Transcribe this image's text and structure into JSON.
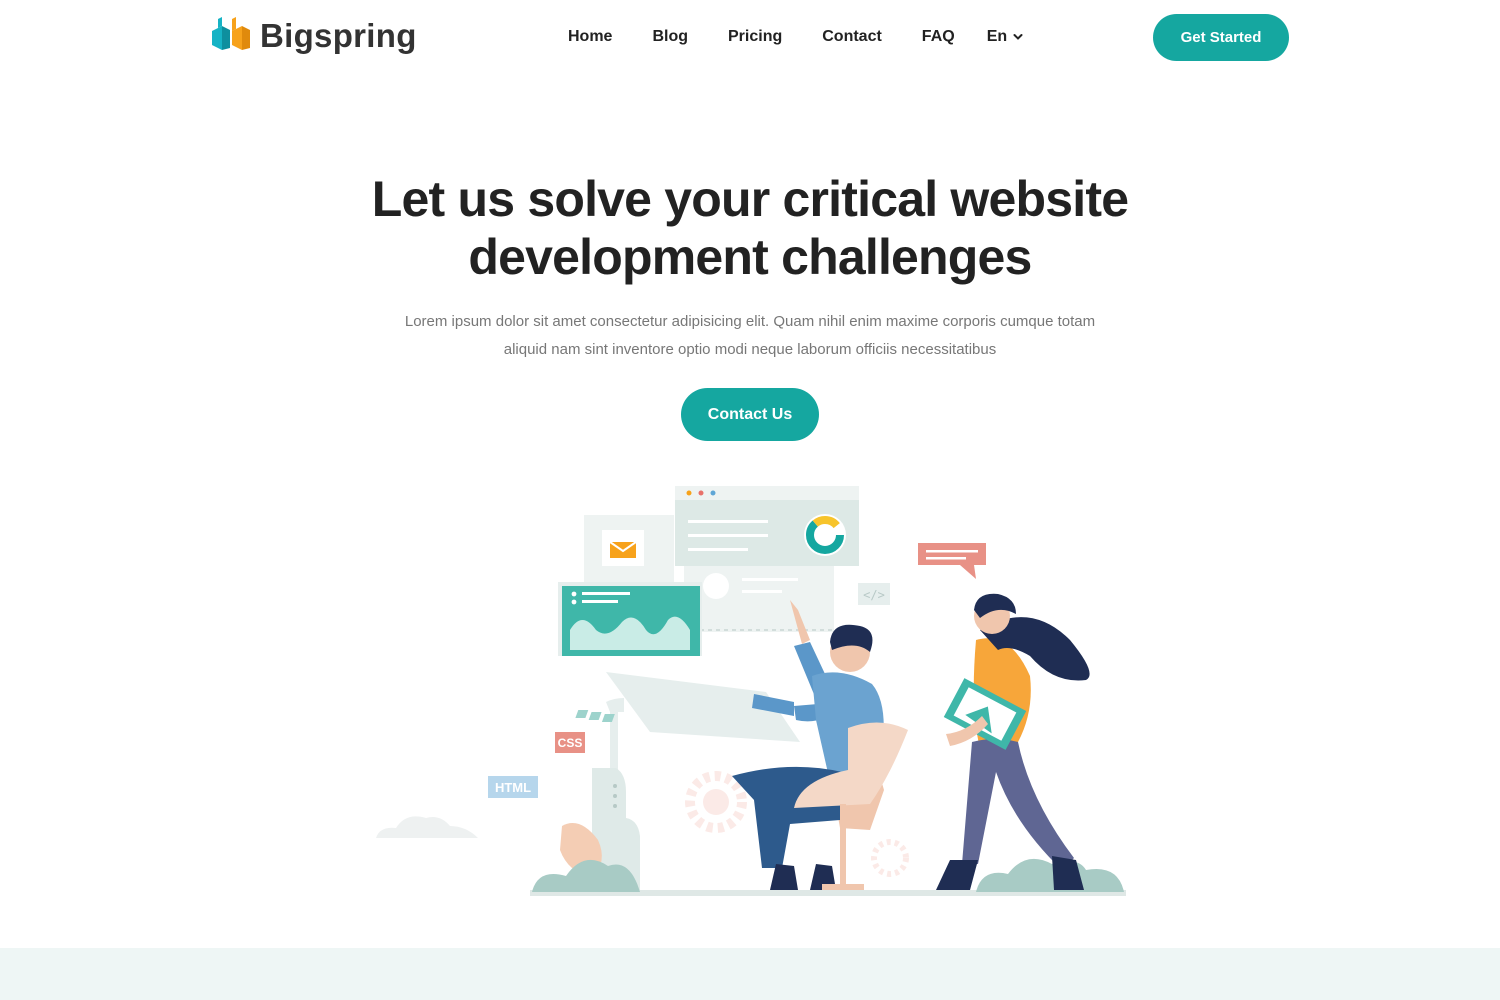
{
  "brand": {
    "name": "Bigspring"
  },
  "nav": {
    "links": [
      "Home",
      "Blog",
      "Pricing",
      "Contact",
      "FAQ"
    ],
    "language": "En",
    "cta_label": "Get Started"
  },
  "hero": {
    "title": "Let us solve your critical website development challenges",
    "subtitle": "Lorem ipsum dolor sit amet consectetur adipisicing elit. Quam nihil enim maxime corporis cumque totam aliquid nam sint inventore optio modi neque laborum officiis necessitatibus",
    "cta_label": "Contact Us"
  },
  "illustration": {
    "css_tag": "CSS",
    "html_tag": "HTML",
    "code_tag": "</>"
  },
  "colors": {
    "accent": "#15a7a0",
    "logo_teal": "#16b3c5",
    "logo_orange": "#f7a21b",
    "heading": "#222222",
    "body_text": "#777777",
    "band": "#eef6f5"
  }
}
